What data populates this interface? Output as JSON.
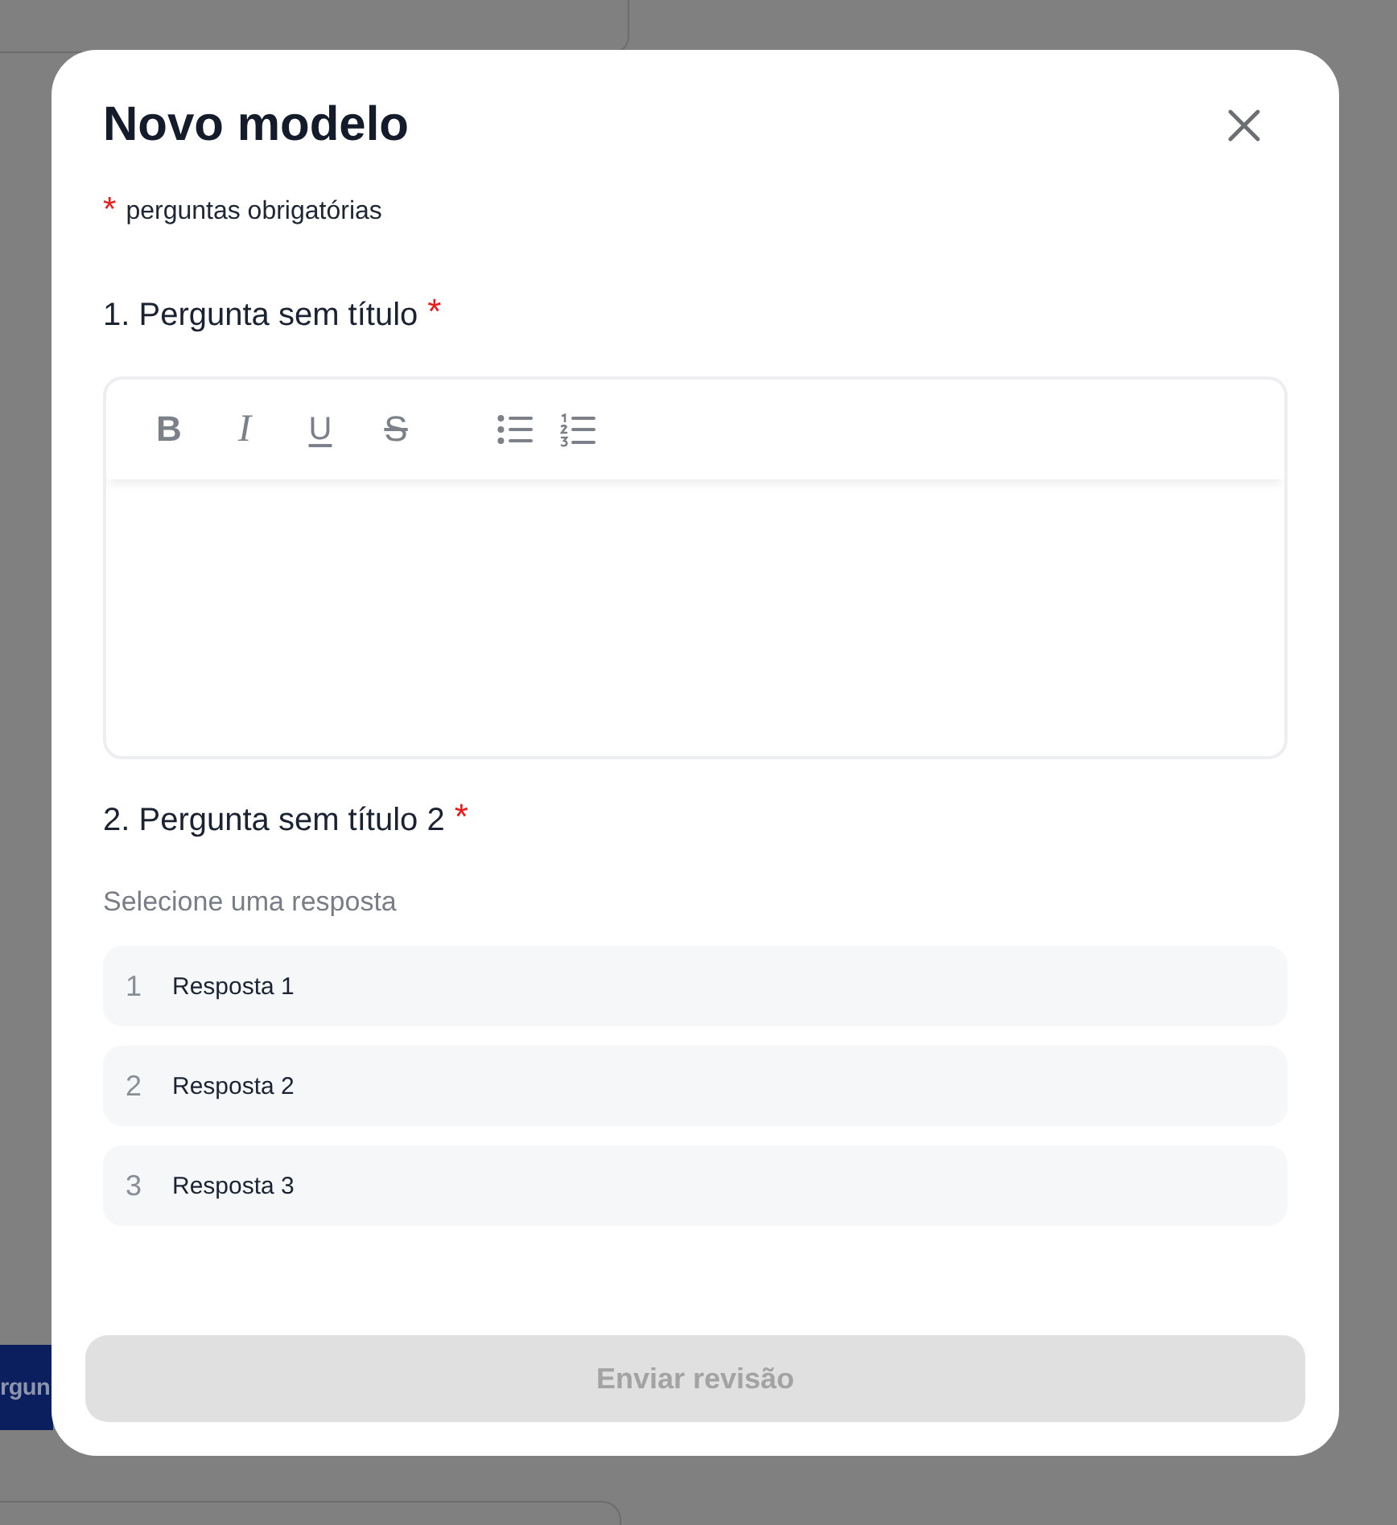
{
  "background_page": {
    "button": "rgun"
  },
  "dialog": {
    "title": "Novo modelo",
    "legend": {
      "mark": "*",
      "text": "perguntas obrigatórias"
    },
    "questions": [
      {
        "kind": "text",
        "title": "1. Pergunta sem título",
        "required_mark": "*",
        "toolbar": [
          {
            "kind": "bold",
            "label": "B"
          },
          {
            "kind": "italic",
            "label": "I"
          },
          {
            "kind": "underline",
            "label": "U"
          },
          {
            "kind": "strike",
            "label": "S"
          },
          {
            "kind": "bullets"
          },
          {
            "kind": "numbers"
          }
        ]
      },
      {
        "kind": "choice",
        "title": "2. Pergunta sem título 2",
        "required_mark": "*",
        "prompt": "Selecione uma resposta",
        "options": [
          {
            "number": "1",
            "label": "Resposta 1",
            "selected": false
          },
          {
            "number": "2",
            "label": "Resposta 2",
            "selected": false
          },
          {
            "number": "3",
            "label": "Resposta 3",
            "selected": false
          }
        ]
      }
    ],
    "submit": {
      "label": "Enviar revisão",
      "disabled": true
    }
  }
}
